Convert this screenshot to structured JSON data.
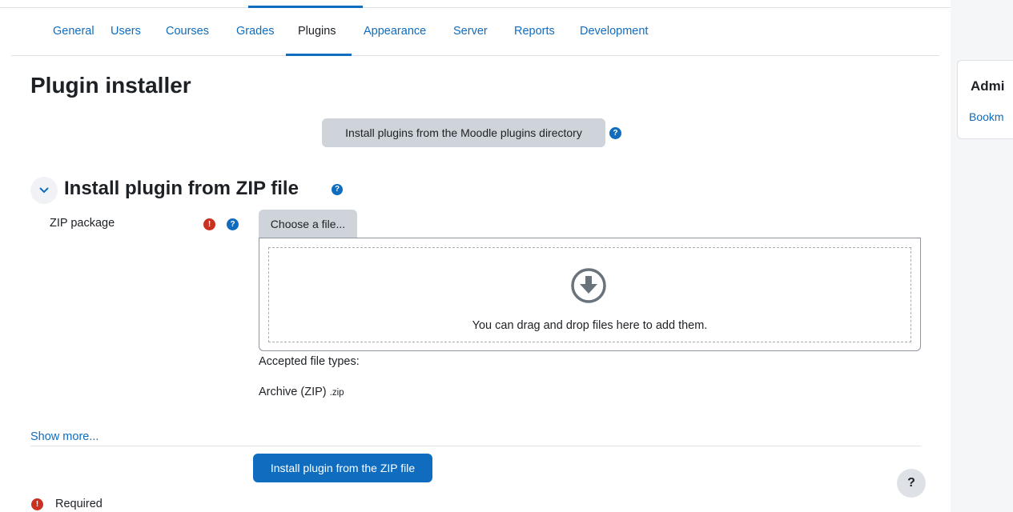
{
  "nav": {
    "tabs": [
      {
        "label": "General"
      },
      {
        "label": "Users"
      },
      {
        "label": "Courses"
      },
      {
        "label": "Grades"
      },
      {
        "label": "Plugins",
        "active": true
      },
      {
        "label": "Appearance"
      },
      {
        "label": "Server"
      },
      {
        "label": "Reports"
      },
      {
        "label": "Development"
      }
    ]
  },
  "page": {
    "title": "Plugin installer",
    "directory_button": "Install plugins from the Moodle plugins directory",
    "help_glyph": "?",
    "required_glyph": "!"
  },
  "section": {
    "heading": "Install plugin from ZIP file",
    "field_label": "ZIP package",
    "choose_button": "Choose a file...",
    "drop_text": "You can drag and drop files here to add them.",
    "accepted_label": "Accepted file types:",
    "file_type_name": "Archive (ZIP)",
    "file_type_ext": ".zip"
  },
  "footer": {
    "show_more": "Show more...",
    "submit_button": "Install plugin from the ZIP file",
    "required_label": "Required",
    "help_fab": "?"
  },
  "drawer": {
    "title": "Admi",
    "link": "Bookm"
  },
  "colors": {
    "primary": "#0f6cbf",
    "required": "#ca3120",
    "secondary_button": "#ced4da"
  }
}
